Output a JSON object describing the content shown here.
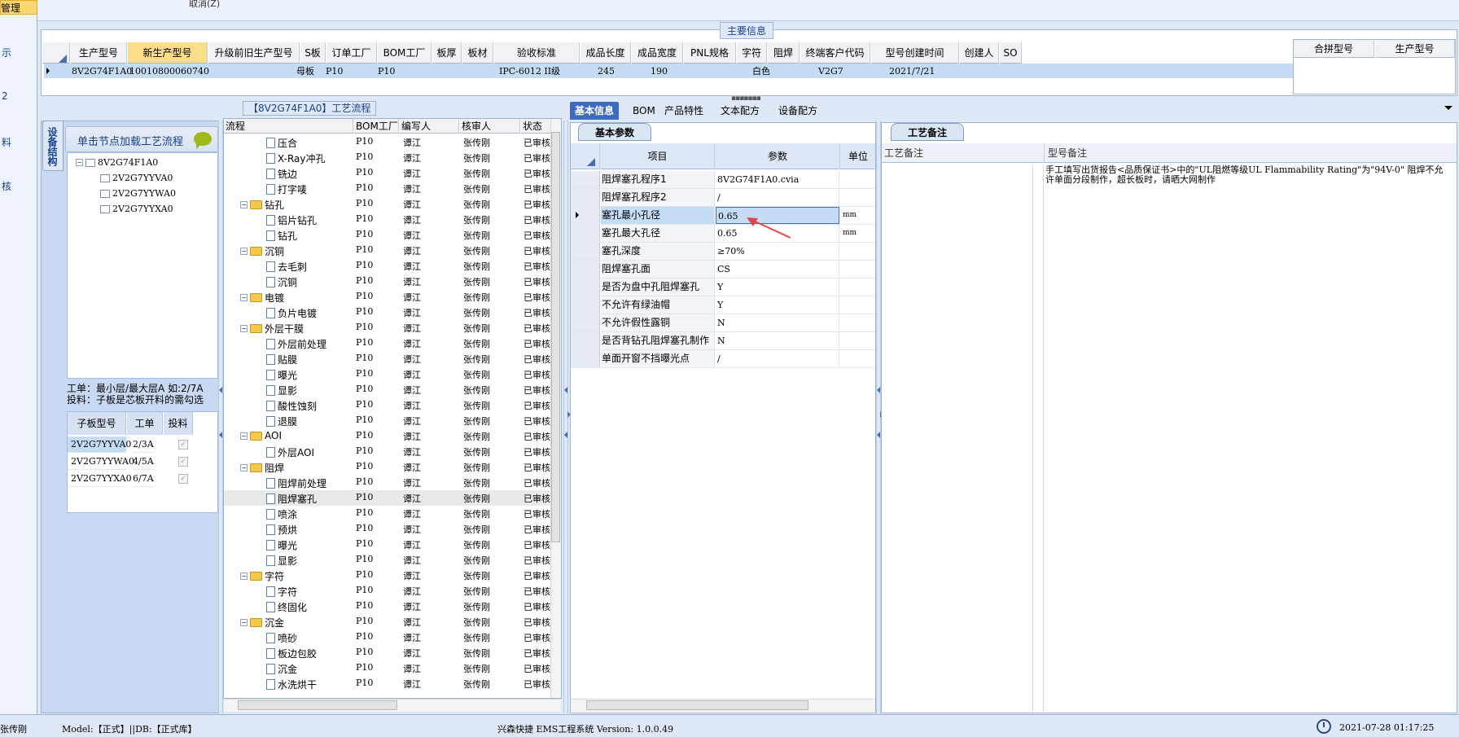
{
  "left_strip": {
    "items": [
      "管理",
      "示",
      "2",
      "料",
      "核"
    ]
  },
  "topbar": {
    "cancel_label": "取消(Z)"
  },
  "main_info": {
    "title": "主要信息",
    "columns": [
      "生产型号",
      "新生产型号",
      "升级前旧生产型号",
      "S板",
      "订单工厂",
      "BOM工厂",
      "板厚",
      "板材",
      "验收标准",
      "成品长度",
      "成品宽度",
      "PNL规格",
      "字符",
      "阻焊",
      "终端客户代码",
      "型号创建时间",
      "创建人",
      "SO"
    ],
    "row": {
      "model": "8V2G74F1A0",
      "new_model": "10010800060740",
      "s_board": "母板",
      "order_factory": "P10",
      "bom_factory": "P10",
      "standard": "IPC-6012 II级",
      "length": "245",
      "width": "190",
      "silkscreen": "白色",
      "customer_code": "V2G7",
      "created_time": "2021/7/21"
    },
    "right_columns": [
      "合拼型号",
      "生产型号"
    ]
  },
  "device_panel": {
    "tab_label": "设备结构",
    "hint": "单击节点加载工艺流程",
    "tree": {
      "root": "8V2G74F1A0",
      "children": [
        "2V2G7YYVA0",
        "2V2G7YYWA0",
        "2V2G7YYXA0"
      ]
    },
    "note_line1": "工单：最小层/最大层A 如:2/7A",
    "note_line2": "投料：子板是芯板开料的需勾选",
    "subgrid_headers": [
      "子板型号",
      "工单",
      "投料"
    ],
    "subgrid_rows": [
      {
        "model": "2V2G7YYVA0",
        "order": "2/3A",
        "feed": "✓"
      },
      {
        "model": "2V2G7YYWA0",
        "order": "4/5A",
        "feed": "✓"
      },
      {
        "model": "2V2G7YYXA0",
        "order": "6/7A",
        "feed": "✓"
      }
    ]
  },
  "flow_panel": {
    "title": "【8V2G74F1A0】工艺流程",
    "headers": [
      "流程",
      "BOM工厂",
      "编写人",
      "核审人",
      "状态"
    ],
    "rows": [
      {
        "name": "压合",
        "level": 2,
        "folder": false
      },
      {
        "name": "X-Ray冲孔",
        "level": 2,
        "folder": false
      },
      {
        "name": "铣边",
        "level": 2,
        "folder": false
      },
      {
        "name": "打字唛",
        "level": 2,
        "folder": false
      },
      {
        "name": "钻孔",
        "level": 1,
        "folder": true
      },
      {
        "name": "铝片钻孔",
        "level": 2,
        "folder": false
      },
      {
        "name": "钻孔",
        "level": 2,
        "folder": false
      },
      {
        "name": "沉铜",
        "level": 1,
        "folder": true
      },
      {
        "name": "去毛刺",
        "level": 2,
        "folder": false
      },
      {
        "name": "沉铜",
        "level": 2,
        "folder": false
      },
      {
        "name": "电镀",
        "level": 1,
        "folder": true
      },
      {
        "name": "负片电镀",
        "level": 2,
        "folder": false
      },
      {
        "name": "外层干膜",
        "level": 1,
        "folder": true
      },
      {
        "name": "外层前处理",
        "level": 2,
        "folder": false
      },
      {
        "name": "贴膜",
        "level": 2,
        "folder": false
      },
      {
        "name": "曝光",
        "level": 2,
        "folder": false
      },
      {
        "name": "显影",
        "level": 2,
        "folder": false
      },
      {
        "name": "酸性蚀刻",
        "level": 2,
        "folder": false
      },
      {
        "name": "退膜",
        "level": 2,
        "folder": false
      },
      {
        "name": "AOI",
        "level": 1,
        "folder": true
      },
      {
        "name": "外层AOI",
        "level": 2,
        "folder": false
      },
      {
        "name": "阻焊",
        "level": 1,
        "folder": true
      },
      {
        "name": "阻焊前处理",
        "level": 2,
        "folder": false
      },
      {
        "name": "阻焊塞孔",
        "level": 2,
        "folder": false,
        "selected": true
      },
      {
        "name": "喷涂",
        "level": 2,
        "folder": false
      },
      {
        "name": "预烘",
        "level": 2,
        "folder": false
      },
      {
        "name": "曝光",
        "level": 2,
        "folder": false
      },
      {
        "name": "显影",
        "level": 2,
        "folder": false
      },
      {
        "name": "字符",
        "level": 1,
        "folder": true
      },
      {
        "name": "字符",
        "level": 2,
        "folder": false
      },
      {
        "name": "终固化",
        "level": 2,
        "folder": false
      },
      {
        "name": "沉金",
        "level": 1,
        "folder": true
      },
      {
        "name": "喷砂",
        "level": 2,
        "folder": false
      },
      {
        "name": "板边包胶",
        "level": 2,
        "folder": false
      },
      {
        "name": "沉金",
        "level": 2,
        "folder": false
      },
      {
        "name": "水洗烘干",
        "level": 2,
        "folder": false
      }
    ],
    "bom_factory": "P10",
    "writer": "谭江",
    "reviewer": "张传刚",
    "status": "已审核"
  },
  "right_tabs": [
    "基本信息",
    "BOM",
    "产品特性",
    "文本配方",
    "设备配方"
  ],
  "params_panel": {
    "tab_label": "基本参数",
    "headers": [
      "项目",
      "参数",
      "单位"
    ],
    "rows": [
      {
        "item": "阻焊塞孔程序1",
        "value": "8V2G74F1A0.cvia",
        "unit": ""
      },
      {
        "item": "阻焊塞孔程序2",
        "value": "/",
        "unit": ""
      },
      {
        "item": "塞孔最小孔径",
        "value": "0.65",
        "unit": "mm",
        "selected": true
      },
      {
        "item": "塞孔最大孔径",
        "value": "0.65",
        "unit": "mm"
      },
      {
        "item": "塞孔深度",
        "value": "≥70%",
        "unit": ""
      },
      {
        "item": "阻焊塞孔面",
        "value": "CS",
        "unit": ""
      },
      {
        "item": "是否为盘中孔阻焊塞孔",
        "value": "Y",
        "unit": ""
      },
      {
        "item": "不允许有绿油帽",
        "value": "Y",
        "unit": ""
      },
      {
        "item": "不允许假性露铜",
        "value": "N",
        "unit": ""
      },
      {
        "item": "是否背钻孔阻焊塞孔制作",
        "value": "N",
        "unit": ""
      },
      {
        "item": "单面开窗不挡曝光点",
        "value": "/",
        "unit": ""
      }
    ]
  },
  "remarks_panel": {
    "tab_label": "工艺备注",
    "headers": [
      "工艺备注",
      "型号备注"
    ],
    "model_remark": "手工填写出货报告<品质保证书>中的\"UL阻燃等级UL Flammability Rating\"为\"94V-0\" 阻焊不允许单面分段制作，超长板时，请晒大网制作"
  },
  "status_bar": {
    "user": "张传刚",
    "model_db": "Model:【正式】||DB:【正式库】",
    "system": "兴森快捷 EMS工程系统 Version: 1.0.0.49",
    "datetime": "2021-07-28 01:17:25"
  }
}
